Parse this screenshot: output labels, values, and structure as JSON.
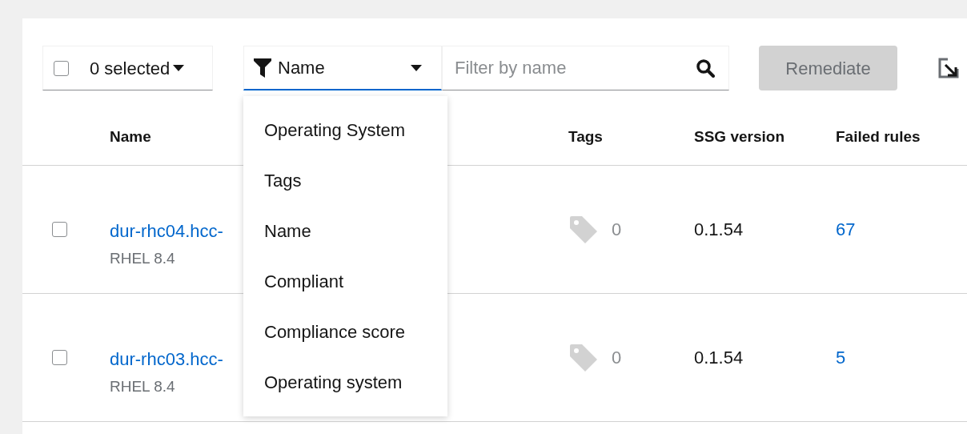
{
  "toolbar": {
    "bulk_select": {
      "checked": false,
      "label": "0 selected"
    },
    "filter": {
      "label": "Name",
      "expanded": true
    },
    "search": {
      "placeholder": "Filter by name"
    },
    "remediate": {
      "label": "Remediate",
      "disabled": true
    }
  },
  "filter_menu": [
    {
      "label": "Operating System"
    },
    {
      "label": "Tags"
    },
    {
      "label": "Name"
    },
    {
      "label": "Compliant"
    },
    {
      "label": "Compliance score"
    },
    {
      "label": "Operating system"
    }
  ],
  "table": {
    "columns": [
      "Name",
      "Tags",
      "SSG version",
      "Failed rules"
    ],
    "rows": [
      {
        "checked": false,
        "name": "dur-rhc04.hcc-",
        "os": "RHEL 8.4",
        "tags": "0",
        "ssg_version": "0.1.54",
        "failed_rules": "67"
      },
      {
        "checked": false,
        "name": "dur-rhc03.hcc-",
        "os": "RHEL 8.4",
        "tags": "0",
        "ssg_version": "0.1.54",
        "failed_rules": "5"
      }
    ]
  }
}
